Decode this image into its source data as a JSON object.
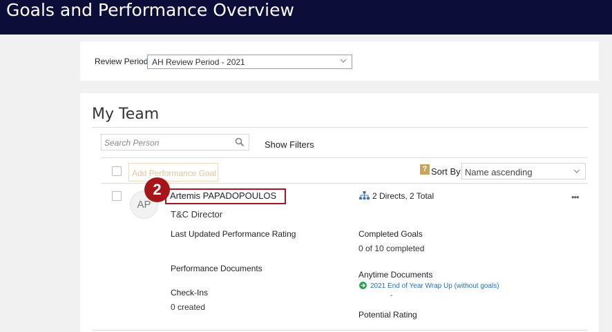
{
  "header": {
    "title": "Goals and Performance Overview"
  },
  "review": {
    "label": "Review Period",
    "value": "AH Review Period - 2021"
  },
  "team": {
    "title": "My Team",
    "search_placeholder": "Search Person",
    "show_filters": "Show Filters",
    "add_goal": "Add Performance Goal",
    "sort_label": "Sort By",
    "sort_value": "Name ascending",
    "help_glyph": "?"
  },
  "person": {
    "step_badge": "2",
    "initials": "AP",
    "name": "Artemis PAPADOPOULOS",
    "job": "T&C Director",
    "directs": "2 Directs, 2 Total",
    "more": "•••",
    "last_rating_label": "Last Updated Performance Rating",
    "perf_docs_label": "Performance Documents",
    "checkins_label": "Check-Ins",
    "checkins_value": "0 created",
    "completed_label": "Completed Goals",
    "completed_value": "0 of 10 completed",
    "anytime_label": "Anytime Documents",
    "anytime_link": "2021 End of Year Wrap Up (without goals)",
    "anytime_extra": "-",
    "potential_label": "Potential Rating"
  },
  "colors": {
    "header_bg": "#0d0d3a",
    "highlight": "#a5161a",
    "link": "#1f6fb2"
  }
}
